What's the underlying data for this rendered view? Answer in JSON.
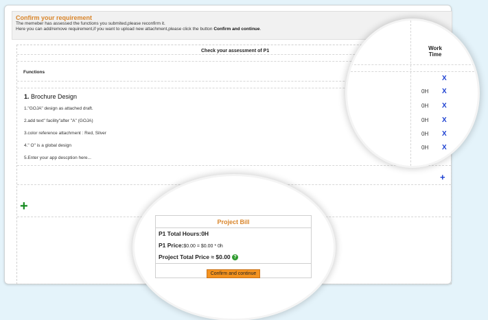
{
  "header": {
    "title": "Confirm your requirement",
    "line1": "The memeber has assessed the functions you submited,please reconfirm it.",
    "line2_prefix": "Here you can add/remove requirement,if you want to upload new attachment,please click the button ",
    "line2_bold": "Confirm and continue",
    "line2_suffix": "."
  },
  "table": {
    "check_title": "Check your assessment of P1",
    "functions_label": "Functions",
    "work_time_line1": "Work",
    "work_time_line2": "Time",
    "module": {
      "number": "1.",
      "name": "Brochure Design"
    },
    "items": [
      "1.\"GOJA\" design as attached draft.",
      "2.add text\" facility\"after \"A\" (GOJA)",
      "3.color reference attachment : Red, Silver",
      "4.\" O\" is a global design",
      "5.Enter your app descption here..."
    ],
    "hours": [
      "0H",
      "0H",
      "0H",
      "0H",
      "0H"
    ],
    "remove_glyph": "X",
    "add_item_glyph": "+",
    "add_module_glyph": "+"
  },
  "bill": {
    "title": "Project Bill",
    "total_hours_label": "P1 Total Hours:",
    "total_hours_value": "0H",
    "price_label": "P1 Price:",
    "price_value": "$0.00",
    "price_formula": " = $0.00 * 0h",
    "total_price_label": "Project Total Price ≈ $0.00",
    "help_glyph": "?",
    "confirm_button": "Confirm and continue"
  },
  "colors": {
    "accent_orange": "#d9852a",
    "button_orange": "#f49320",
    "add_green": "#148a1f",
    "link_blue": "#1b3fd1",
    "page_bg": "#e4f3fa"
  }
}
